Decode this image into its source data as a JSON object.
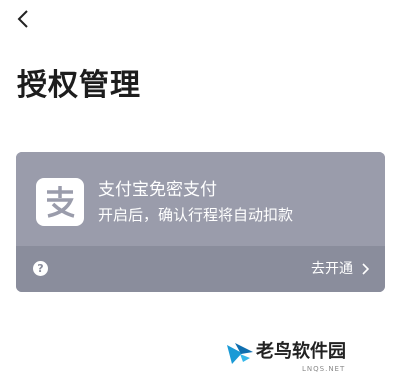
{
  "header": {
    "back_icon": "chevron-left-icon",
    "title": "授权管理"
  },
  "auth_card": {
    "logo_icon": "alipay-logo-icon",
    "service_name": "支付宝免密支付",
    "description": "开启后，确认行程将自动扣款",
    "help_icon": "help-circle-icon",
    "help_glyph": "?",
    "action_label": "去开通",
    "action_icon": "chevron-right-icon",
    "colors": {
      "card_top": "#9a9cab",
      "card_bottom": "#8a8d9c",
      "logo_brand": "#9a9cab"
    }
  },
  "watermark": {
    "text": "老鸟软件园",
    "subtext": "LNQS.NET"
  }
}
